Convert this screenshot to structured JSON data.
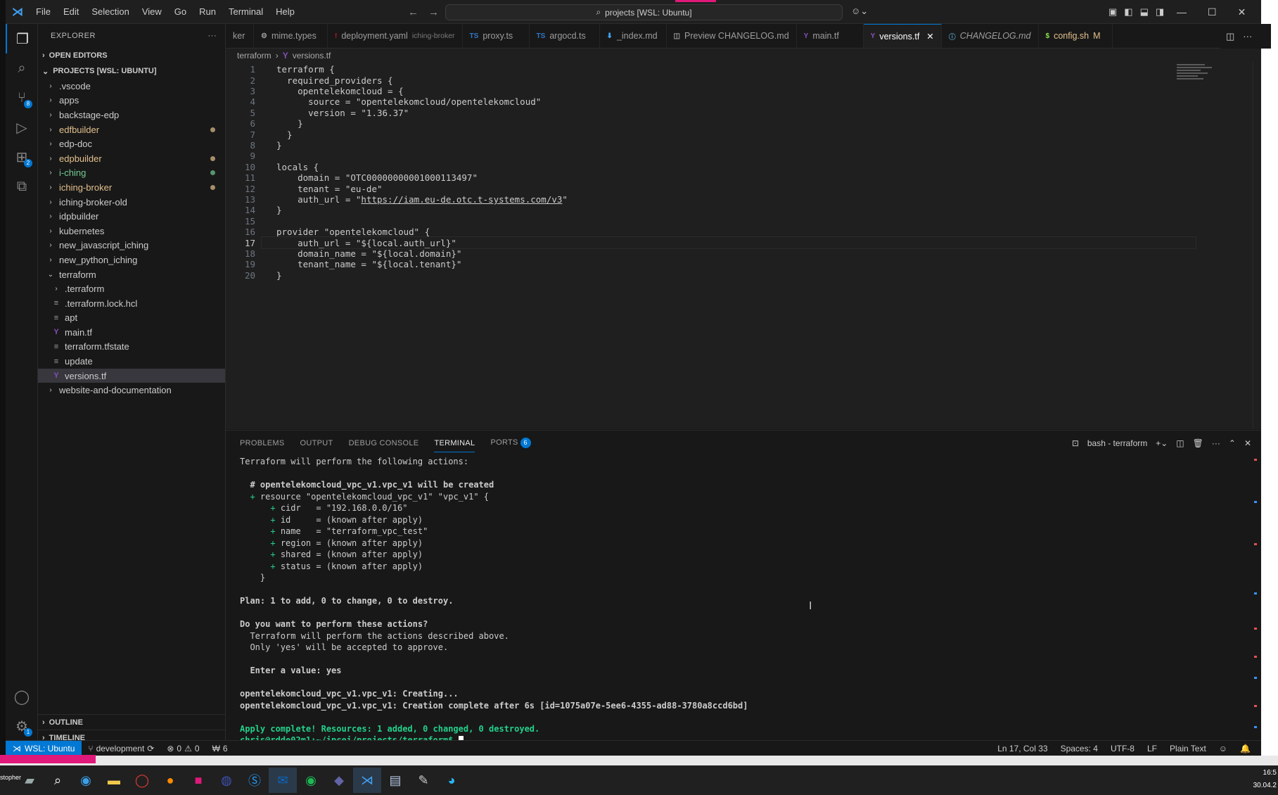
{
  "titlebar": {
    "menu": [
      "File",
      "Edit",
      "Selection",
      "View",
      "Go",
      "Run",
      "Terminal",
      "Help"
    ],
    "search_text": "projects [WSL: Ubuntu]"
  },
  "sidebar": {
    "title": "EXPLORER",
    "open_editors": "OPEN EDITORS",
    "projects": "PROJECTS [WSL: UBUNTU]",
    "items": [
      {
        "label": ".vscode",
        "indent": 1,
        "folder": true,
        "status": "normal"
      },
      {
        "label": "apps",
        "indent": 1,
        "folder": true,
        "status": "normal"
      },
      {
        "label": "backstage-edp",
        "indent": 1,
        "folder": true,
        "status": "normal"
      },
      {
        "label": "edfbuilder",
        "indent": 1,
        "folder": true,
        "status": "yellow"
      },
      {
        "label": "edp-doc",
        "indent": 1,
        "folder": true,
        "status": "normal"
      },
      {
        "label": "edpbuilder",
        "indent": 1,
        "folder": true,
        "status": "yellow"
      },
      {
        "label": "i-ching",
        "indent": 1,
        "folder": true,
        "status": "green"
      },
      {
        "label": "iching-broker",
        "indent": 1,
        "folder": true,
        "status": "yellow"
      },
      {
        "label": "iching-broker-old",
        "indent": 1,
        "folder": true,
        "status": "normal"
      },
      {
        "label": "idpbuilder",
        "indent": 1,
        "folder": true,
        "status": "normal"
      },
      {
        "label": "kubernetes",
        "indent": 1,
        "folder": true,
        "status": "normal"
      },
      {
        "label": "new_javascript_iching",
        "indent": 1,
        "folder": true,
        "status": "normal"
      },
      {
        "label": "new_python_iching",
        "indent": 1,
        "folder": true,
        "status": "normal"
      },
      {
        "label": "terraform",
        "indent": 1,
        "folder": true,
        "open": true,
        "status": "normal"
      },
      {
        "label": ".terraform",
        "indent": 2,
        "folder": true,
        "status": "normal"
      },
      {
        "label": ".terraform.lock.hcl",
        "indent": 2,
        "folder": false,
        "status": "normal"
      },
      {
        "label": "apt",
        "indent": 2,
        "folder": false,
        "status": "normal"
      },
      {
        "label": "main.tf",
        "indent": 2,
        "folder": false,
        "tf": true,
        "status": "normal"
      },
      {
        "label": "terraform.tfstate",
        "indent": 2,
        "folder": false,
        "status": "normal"
      },
      {
        "label": "update",
        "indent": 2,
        "folder": false,
        "status": "normal"
      },
      {
        "label": "versions.tf",
        "indent": 2,
        "folder": false,
        "tf": true,
        "status": "normal",
        "selected": true
      },
      {
        "label": "website-and-documentation",
        "indent": 1,
        "folder": true,
        "status": "normal"
      }
    ],
    "outline": "OUTLINE",
    "timeline": "TIMELINE"
  },
  "tabs": [
    {
      "label": "ker",
      "icon": "",
      "desc": ""
    },
    {
      "label": "mime.types",
      "icon": "⚙",
      "desc": ""
    },
    {
      "label": "deployment.yaml",
      "icon": "!",
      "desc": "iching-broker"
    },
    {
      "label": "proxy.ts",
      "icon": "TS",
      "desc": ""
    },
    {
      "label": "argocd.ts",
      "icon": "TS",
      "desc": ""
    },
    {
      "label": "_index.md",
      "icon": "⬇",
      "desc": ""
    },
    {
      "label": "Preview CHANGELOG.md",
      "icon": "◫",
      "desc": ""
    },
    {
      "label": "main.tf",
      "icon": "Y",
      "desc": ""
    },
    {
      "label": "versions.tf",
      "icon": "Y",
      "desc": "",
      "active": true
    },
    {
      "label": "CHANGELOG.md",
      "icon": "ⓘ",
      "desc": "",
      "italic": true
    },
    {
      "label": "config.sh",
      "icon": "$",
      "desc": "",
      "modified": "M"
    }
  ],
  "breadcrumb": {
    "folder": "terraform",
    "file": "versions.tf"
  },
  "editor": {
    "current_line": 17,
    "lines": [
      "terraform {",
      "  required_providers {",
      "    opentelekomcloud = {",
      "      source = \"opentelekomcloud/opentelekomcloud\"",
      "      version = \"1.36.37\"",
      "    }",
      "  }",
      "}",
      "",
      "locals {",
      "    domain = \"OTC00000000001000113497\"",
      "    tenant = \"eu-de\"",
      "    auth_url = \"https://iam.eu-de.otc.t-systems.com/v3\"",
      "}",
      "",
      "provider \"opentelekomcloud\" {",
      "    auth_url = \"${local.auth_url}\"",
      "    domain_name = \"${local.domain}\"",
      "    tenant_name = \"${local.tenant}\"",
      "}"
    ]
  },
  "panel": {
    "tabs": [
      "PROBLEMS",
      "OUTPUT",
      "DEBUG CONSOLE",
      "TERMINAL",
      "PORTS"
    ],
    "active_tab": "TERMINAL",
    "ports_badge": "6",
    "terminal_name": "bash - terraform",
    "terminal_lines": [
      {
        "text": "Terraform will perform the following actions:",
        "cls": ""
      },
      {
        "text": "",
        "cls": ""
      },
      {
        "text": "  # opentelekomcloud_vpc_v1.vpc_v1 will be created",
        "cls": "b"
      },
      {
        "text": "  + resource \"opentelekomcloud_vpc_v1\" \"vpc_v1\" {",
        "cls": ""
      },
      {
        "text": "      + cidr   = \"192.168.0.0/16\"",
        "cls": ""
      },
      {
        "text": "      + id     = (known after apply)",
        "cls": ""
      },
      {
        "text": "      + name   = \"terraform_vpc_test\"",
        "cls": ""
      },
      {
        "text": "      + region = (known after apply)",
        "cls": ""
      },
      {
        "text": "      + shared = (known after apply)",
        "cls": ""
      },
      {
        "text": "      + status = (known after apply)",
        "cls": ""
      },
      {
        "text": "    }",
        "cls": ""
      },
      {
        "text": "",
        "cls": ""
      },
      {
        "text": "Plan: 1 to add, 0 to change, 0 to destroy.",
        "cls": "b"
      },
      {
        "text": "",
        "cls": ""
      },
      {
        "text": "Do you want to perform these actions?",
        "cls": "b"
      },
      {
        "text": "  Terraform will perform the actions described above.",
        "cls": ""
      },
      {
        "text": "  Only 'yes' will be accepted to approve.",
        "cls": ""
      },
      {
        "text": "",
        "cls": ""
      },
      {
        "text": "  Enter a value: yes",
        "cls": "b"
      },
      {
        "text": "",
        "cls": ""
      },
      {
        "text": "opentelekomcloud_vpc_v1.vpc_v1: Creating...",
        "cls": "b"
      },
      {
        "text": "opentelekomcloud_vpc_v1.vpc_v1: Creation complete after 6s [id=1075a07e-5ee6-4355-ad88-3780a8ccd6bd]",
        "cls": "b"
      },
      {
        "text": "",
        "cls": ""
      },
      {
        "text": "Apply complete! Resources: 1 added, 0 changed, 0 destroyed.",
        "cls": "g b"
      },
      {
        "text": "chris@rdde02m1:~/ipcei/projects/terraform$ ",
        "cls": "g b prompt"
      }
    ]
  },
  "statusbar": {
    "remote": "WSL: Ubuntu",
    "branch": "development",
    "errors": "0",
    "warnings": "0",
    "ports": "6",
    "position": "Ln 17, Col 33",
    "spaces": "Spaces: 4",
    "encoding": "UTF-8",
    "eol": "LF",
    "language": "Plain Text"
  },
  "taskbar": {
    "user": "stopher",
    "time": "16:5",
    "date": "30.04.2"
  },
  "colors": {
    "accent": "#0078d4",
    "modified": "#e2c08d",
    "untracked": "#73c991",
    "terminal_green": "#23d18b",
    "recording_pink": "#e0187a"
  }
}
